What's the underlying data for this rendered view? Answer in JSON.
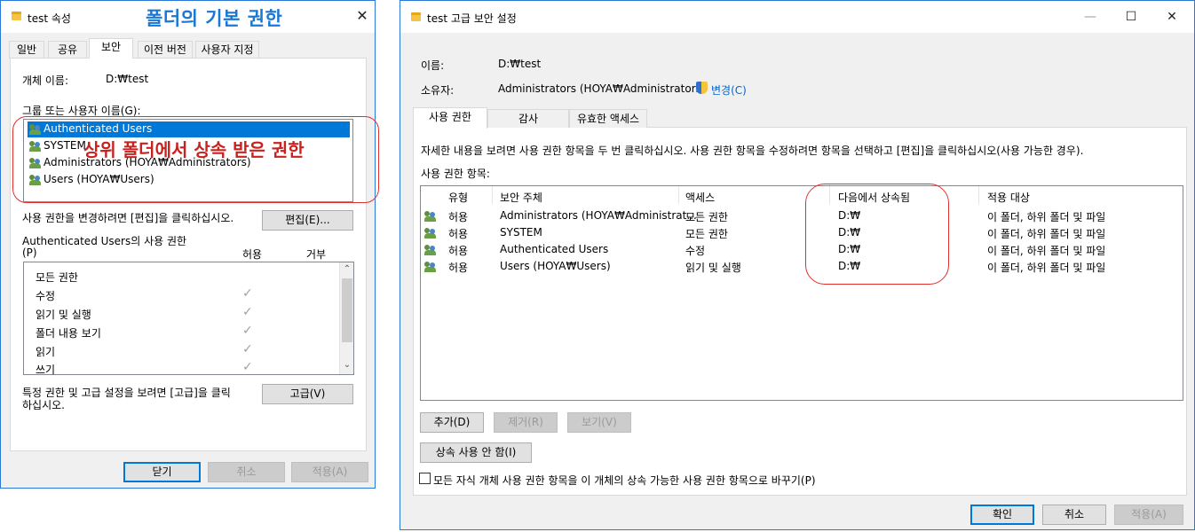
{
  "left": {
    "title": "test 속성",
    "heading": "폴더의 기본 권한",
    "tabs": [
      {
        "label": "일반"
      },
      {
        "label": "공유"
      },
      {
        "label": "보안"
      },
      {
        "label": "이전 버전"
      },
      {
        "label": "사용자 지정"
      }
    ],
    "object_name_label": "개체 이름:",
    "object_name_value": "D:₩test",
    "group_label": "그룹 또는 사용자 이름(G):",
    "groups": [
      {
        "name": "Authenticated Users"
      },
      {
        "name": "SYSTEM"
      },
      {
        "name": "Administrators (HOYA₩Administrators)"
      },
      {
        "name": "Users (HOYA₩Users)"
      }
    ],
    "annotation": "상위 폴더에서 상속 받은 권한",
    "change_hint": "사용 권한을 변경하려면 [편집]을 클릭하십시오.",
    "edit_button": "편집(E)...",
    "perm_for_label": "Authenticated Users의 사용 권한",
    "perm_p": "(P)",
    "allow_header": "허용",
    "deny_header": "거부",
    "permissions": [
      {
        "name": "모든 권한",
        "allow": false
      },
      {
        "name": "수정",
        "allow": true
      },
      {
        "name": "읽기 및 실행",
        "allow": true
      },
      {
        "name": "폴더 내용 보기",
        "allow": true
      },
      {
        "name": "읽기",
        "allow": true
      },
      {
        "name": "쓰기",
        "allow": true
      }
    ],
    "check_glyph": "✓",
    "advanced_hint_1": "특정 권한 및 고급 설정을 보려면 [고급]을 클릭",
    "advanced_hint_2": "하십시오.",
    "advanced_button": "고급(V)",
    "close_button": "닫기",
    "cancel_button": "취소",
    "apply_button": "적용(A)",
    "close_glyph": "✕"
  },
  "right": {
    "title": "test 고급 보안 설정",
    "name_label": "이름:",
    "name_value": "D:₩test",
    "owner_label": "소유자:",
    "owner_value": "Administrators (HOYA₩Administrators)",
    "change_link": "변경(C)",
    "tabs": [
      {
        "label": "사용 권한"
      },
      {
        "label": "감사"
      },
      {
        "label": "유효한 액세스"
      }
    ],
    "info_text": "자세한 내용을 보려면 사용 권한 항목을 두 번 클릭하십시오. 사용 권한 항목을 수정하려면 항목을 선택하고 [편집]을 클릭하십시오(사용 가능한 경우).",
    "entries_label": "사용 권한 항목:",
    "columns": {
      "type": "유형",
      "principal": "보안 주체",
      "access": "액세스",
      "inherited": "다음에서 상속됨",
      "applies": "적용 대상"
    },
    "rows": [
      {
        "type": "허용",
        "principal": "Administrators (HOYA₩Administrat...",
        "access": "모든 권한",
        "inherited": "D:₩",
        "applies": "이 폴더, 하위 폴더 및 파일"
      },
      {
        "type": "허용",
        "principal": "SYSTEM",
        "access": "모든 권한",
        "inherited": "D:₩",
        "applies": "이 폴더, 하위 폴더 및 파일"
      },
      {
        "type": "허용",
        "principal": "Authenticated Users",
        "access": "수정",
        "inherited": "D:₩",
        "applies": "이 폴더, 하위 폴더 및 파일"
      },
      {
        "type": "허용",
        "principal": "Users (HOYA₩Users)",
        "access": "읽기 및 실행",
        "inherited": "D:₩",
        "applies": "이 폴더, 하위 폴더 및 파일"
      }
    ],
    "add_button": "추가(D)",
    "remove_button": "제거(R)",
    "view_button": "보기(V)",
    "disable_inherit_button": "상속 사용 안 함(I)",
    "replace_label": "모든 자식 개체 사용 권한 항목을 이 개체의 상속 가능한 사용 권한 항목으로 바꾸기(P)",
    "ok_button": "확인",
    "cancel_button": "취소",
    "apply_button": "적용(A)",
    "minimize_glyph": "—",
    "maximize_glyph": "☐",
    "close_glyph": "✕"
  }
}
